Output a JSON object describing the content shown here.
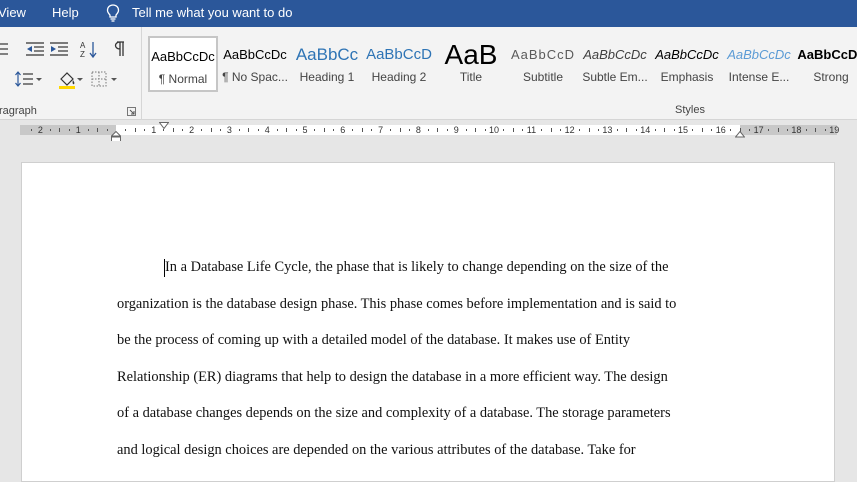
{
  "menu": {
    "view": "View",
    "help": "Help",
    "tell_me": "Tell me what you want to do"
  },
  "paragraph_group": {
    "label": "ragraph"
  },
  "styles_group": {
    "label": "Styles",
    "items": [
      {
        "preview": "AaBbCcDc",
        "name": "¶ Normal"
      },
      {
        "preview": "AaBbCcDc",
        "name": "¶ No Spac..."
      },
      {
        "preview": "AaBbCc",
        "name": "Heading 1"
      },
      {
        "preview": "AaBbCcD",
        "name": "Heading 2"
      },
      {
        "preview": "AaB",
        "name": "Title"
      },
      {
        "preview": "AaBbCcD",
        "name": "Subtitle"
      },
      {
        "preview": "AaBbCcDc",
        "name": "Subtle Em..."
      },
      {
        "preview": "AaBbCcDc",
        "name": "Emphasis"
      },
      {
        "preview": "AaBbCcDc",
        "name": "Intense E..."
      },
      {
        "preview": "AaBbCcDc",
        "name": "Strong"
      }
    ]
  },
  "ruler": {
    "labels": [
      "2",
      "1",
      "1",
      "2",
      "3",
      "4",
      "5",
      "6",
      "7",
      "8",
      "9",
      "10",
      "11",
      "12",
      "13",
      "14",
      "15",
      "16",
      "17",
      "18",
      "19"
    ]
  },
  "document": {
    "lines": [
      "In a Database Life Cycle, the phase that is likely to change depending on the size of the",
      "organization is the database design phase. This phase comes before implementation and is said to",
      "be the process of coming up with a detailed model of the database. It makes use of Entity",
      "Relationship (ER) diagrams that help to design the database in a more efficient way. The design",
      "of a database changes depends on the size and complexity of a database. The storage parameters",
      "and logical design choices are depended on the various attributes of the database. Take for"
    ]
  },
  "colors": {
    "title_bar": "#2b579a",
    "ribbon": "#f3f3f3",
    "workspace": "#e6e6e6",
    "heading_blue": "#2e74b5"
  }
}
